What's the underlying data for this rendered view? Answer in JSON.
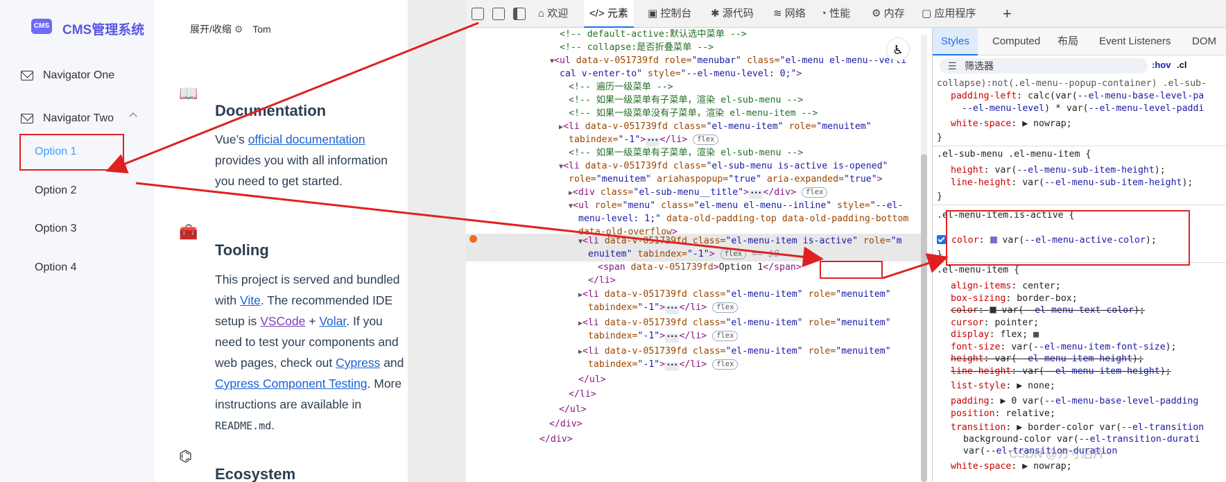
{
  "app": {
    "logo_text": "CMS",
    "title": "CMS管理系统",
    "toggle_label": "展开/收缩",
    "user": "Tom",
    "nav": [
      {
        "label": "Navigator One"
      },
      {
        "label": "Navigator Two"
      }
    ],
    "submenu": [
      {
        "label": "Option 1",
        "active": true
      },
      {
        "label": "Option 2"
      },
      {
        "label": "Option 3"
      },
      {
        "label": "Option 4"
      }
    ],
    "sections": {
      "doc_title": "Documentation",
      "doc_pre": "Vue’s ",
      "doc_link": "official documentation",
      "doc_post": " provides you with all information you need to get started.",
      "tool_title": "Tooling",
      "tool_pre": "This project is served and bundled with ",
      "tool_vite": "Vite",
      "tool_mid1": ". The recommended IDE setup is ",
      "tool_vscode": "VSCode",
      "tool_plus": " + ",
      "tool_volar": "Volar",
      "tool_mid2": ". If you need to test your components and web pages, check out ",
      "tool_cypress": "Cypress",
      "tool_and": " and ",
      "tool_cct": "Cypress Component Testing",
      "tool_mid3": ". More instructions are available in ",
      "tool_readme": "README.md",
      "tool_end": ".",
      "eco_title": "Ecosystem"
    }
  },
  "devtools": {
    "tabs": [
      "欢迎",
      "元素",
      "控制台",
      "源代码",
      "网络",
      "性能",
      "内存",
      "应用程序"
    ],
    "active_tab": "元素",
    "add_tab": "+",
    "styles_tabs": [
      "Styles",
      "Computed",
      "布局",
      "Event Listeners",
      "DOM",
      ".cl"
    ],
    "filter_placeholder": "筛选器",
    "hov": ":hov",
    "code": {
      "l1": "<!-- default-active:默认选中菜单 -->",
      "l2": "<!-- collapse:是否折叠菜单 -->",
      "l3a": "<ul ",
      "l3b": "data-v-051739fd",
      "l3c": " role=",
      "l3d": "\"menubar\"",
      "l3e": " class=",
      "l3f": "\"el-menu el-menu--verti",
      "l4a": "cal v-enter-to\"",
      "l4b": " style=",
      "l4c": "\"--el-menu-level: 0;\"",
      "l4d": ">",
      "l5": "<!-- 遍历一级菜单 -->",
      "l6": "<!-- 如果一级菜单有子菜单，渲染 el-sub-menu -->",
      "l7": "<!-- 如果一级菜单没有子菜单，渲染 el-menu-item -->",
      "l8a": "<li ",
      "l8b": "data-v-051739fd",
      "l8c": " class=",
      "l8d": "\"el-menu-item\"",
      "l8e": " role=",
      "l8f": "\"menuitem\"",
      "l9a": "tabindex=",
      "l9b": "\"-1\"",
      "l9c": ">",
      "l9d": "</li>",
      "l10": "<!-- 如果一级菜单有子菜单，渲染 el-sub-menu -->",
      "l11a": "<li ",
      "l11b": "data-v-051739fd",
      "l11c": " class=",
      "l11d": "\"el-sub-menu is-active is-opened\"",
      "l12a": "role=",
      "l12b": "\"menuitem\"",
      "l12c": " ariahaspopup=",
      "l12d": "\"true\"",
      "l12e": " aria-expanded=",
      "l12f": "\"true\"",
      "l12g": ">",
      "l13a": "<div ",
      "l13b": "class=",
      "l13c": "\"el-sub-menu__title\"",
      "l13d": ">",
      "l13e": "</div>",
      "l14a": "<ul ",
      "l14b": "role=",
      "l14c": "\"menu\"",
      "l14d": " class=",
      "l14e": "\"el-menu el-menu--inline\"",
      "l14f": " style=",
      "l14g": "\"--el-",
      "l15a": "menu-level: 1;\"",
      "l15b": " data-old-padding-top data-old-padding-bottom",
      "l16a": "data-old-overflow",
      "l16b": ">",
      "l17a": "<li ",
      "l17b": "data-v-051739fd",
      "l17c": " class=",
      "l17d": "\"el-menu-item ",
      "l17e": "is-active",
      "l17f": "\"",
      "l17g": " role=",
      "l17h": "\"m",
      "l18a": "enuitem\"",
      "l18b": " tabindex=",
      "l18c": "\"-1\"",
      "l18d": ">",
      "l18e": "</li>",
      "l18f": "== $0",
      "l19a": "<span ",
      "l19b": "data-v-051739fd",
      "l19c": ">",
      "l19d": "Option 1",
      "l19e": "</span>",
      "l20": "</li>",
      "l21a": "<li ",
      "l21b": "data-v-051739fd",
      "l21c": " class=",
      "l21d": "\"el-menu-item\"",
      "l21e": " role=",
      "l21f": "\"menuitem\"",
      "l22a": "tabindex=",
      "l22b": "\"-1\"",
      "l22c": ">",
      "l22d": "</li>",
      "l27": "</ul>",
      "l28": "</li>",
      "l29": "</ul>",
      "l30": "</div>",
      "l31": "</div>",
      "flex": "flex",
      "dots": "•••"
    },
    "css": {
      "r0": "collapse):not(.el-menu--popup-container) .el-sub-",
      "r1p": "padding-left",
      "r1v": "calc(var(",
      "r1w": "--el-menu-base-level-pa",
      "r2v": "--el-menu-level",
      "r2w": ") * var(",
      "r2x": "--el-menu-level-paddi",
      "r3p": "white-space",
      "r3v": "nowrap;",
      "close": "}",
      "s1": ".el-sub-menu .el-menu-item {",
      "s2p": "height",
      "s2v": "--el-menu-sub-item-height",
      "s3p": "line-height",
      "s3v": "--el-menu-sub-item-height",
      "a1": ".el-menu-item.is-active {",
      "a2p": "color",
      "a2v": "--el-menu-active-color",
      "m1": ".el-menu-item {",
      "m2p": "align-items",
      "m2v": "center;",
      "m3p": "box-sizing",
      "m3v": "border-box;",
      "m4p": "color",
      "m4v": "--el-menu-text-color",
      "m5p": "cursor",
      "m5v": "pointer;",
      "m6p": "display",
      "m6v": "flex;",
      "m7p": "font-size",
      "m7v": "--el-menu-item-font-size",
      "m8p": "height",
      "m8v": "--el-menu-item-height",
      "m9p": "line-height",
      "m9v": "--el-menu-item-height",
      "m10p": "list-style",
      "m10v": "none;",
      "m11p": "padding",
      "m11v": "0 var(",
      "m11w": "--el-menu-base-level-padding",
      "m12p": "position",
      "m12v": "relative;",
      "m13p": "transition",
      "m13v": "border-color var(",
      "m13w": "--el-transition",
      "m14v": "background-color var(",
      "m14w": "--el-transition-durati",
      "m15v": "var(",
      "m15w": "--el-transition-duration",
      "m16p": "white-space",
      "m16v": "nowrap;"
    },
    "watermark": "CSDN @方寸后片~"
  },
  "colors": {
    "accent": "#409eff",
    "annotation": "#e02020",
    "brand": "#5b54e8"
  }
}
